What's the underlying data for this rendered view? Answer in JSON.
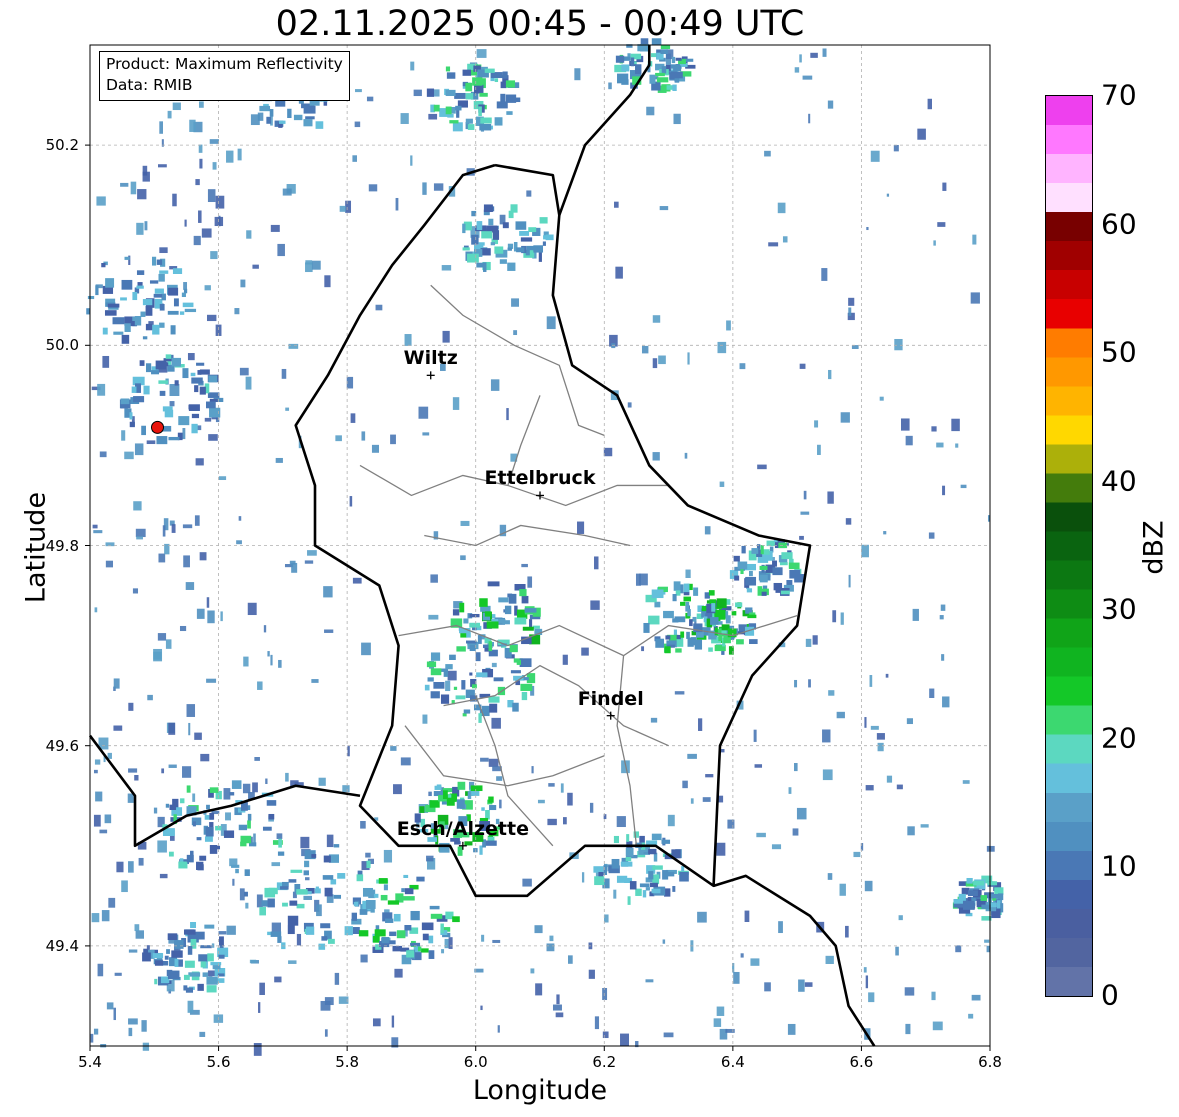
{
  "title": "02.11.2025 00:45 - 00:49 UTC",
  "info": {
    "product": "Product: Maximum Reflectivity",
    "data": "Data: RMIB"
  },
  "axes": {
    "xlabel": "Longitude",
    "ylabel": "Latitude",
    "xlim": [
      5.4,
      6.8
    ],
    "ylim": [
      49.3,
      50.3
    ],
    "xticks": [
      "5.4",
      "5.6",
      "5.8",
      "6.0",
      "6.2",
      "6.4",
      "6.6",
      "6.8"
    ],
    "yticks": [
      "49.4",
      "49.6",
      "49.8",
      "50.0",
      "50.2"
    ]
  },
  "cities": [
    {
      "name": "Wiltz",
      "lon": 5.93,
      "lat": 49.97
    },
    {
      "name": "Ettelbruck",
      "lon": 6.1,
      "lat": 49.85
    },
    {
      "name": "Findel",
      "lon": 6.21,
      "lat": 49.63
    },
    {
      "name": "Esch/Alzette",
      "lon": 5.98,
      "lat": 49.5
    }
  ],
  "radar_marker": {
    "lon": 5.505,
    "lat": 49.918,
    "color": "#e8140c"
  },
  "colorbar": {
    "label": "dBZ",
    "min": 0,
    "max": 70,
    "ticks": [
      "0",
      "10",
      "20",
      "30",
      "40",
      "50",
      "60",
      "70"
    ],
    "colors": [
      "#6273a8",
      "#5265a0",
      "#4a5fa0",
      "#4462a8",
      "#4a78b5",
      "#5090c0",
      "#5aa0c8",
      "#64c0dc",
      "#5cd8c0",
      "#3cd870",
      "#14c828",
      "#10b420",
      "#10a418",
      "#0e8c14",
      "#0c7812",
      "#0a6410",
      "#0a500c",
      "#447c0c",
      "#acb00a",
      "#ffd800",
      "#ffb400",
      "#ff9800",
      "#ff7c00",
      "#e80000",
      "#c80000",
      "#a00000",
      "#780000",
      "#ffe0ff",
      "#ffb4ff",
      "#ff78ff",
      "#ee40ee"
    ]
  },
  "echoes": [
    {
      "lon": 5.47,
      "lat": 50.05,
      "r": 0.06,
      "level": 2
    },
    {
      "lon": 5.52,
      "lat": 49.95,
      "r": 0.06,
      "level": 3
    },
    {
      "lon": 5.6,
      "lat": 49.52,
      "r": 0.07,
      "level": 4
    },
    {
      "lon": 5.75,
      "lat": 49.45,
      "r": 0.08,
      "level": 3
    },
    {
      "lon": 5.88,
      "lat": 49.43,
      "r": 0.06,
      "level": 5
    },
    {
      "lon": 5.97,
      "lat": 49.53,
      "r": 0.05,
      "level": 6
    },
    {
      "lon": 6.03,
      "lat": 49.73,
      "r": 0.05,
      "level": 6
    },
    {
      "lon": 6.0,
      "lat": 49.67,
      "r": 0.06,
      "level": 4
    },
    {
      "lon": 6.32,
      "lat": 49.73,
      "r": 0.05,
      "level": 5
    },
    {
      "lon": 6.38,
      "lat": 49.72,
      "r": 0.04,
      "level": 6
    },
    {
      "lon": 6.45,
      "lat": 49.78,
      "r": 0.04,
      "level": 4
    },
    {
      "lon": 6.04,
      "lat": 50.11,
      "r": 0.05,
      "level": 3
    },
    {
      "lon": 5.99,
      "lat": 50.25,
      "r": 0.05,
      "level": 4
    },
    {
      "lon": 5.72,
      "lat": 50.25,
      "r": 0.05,
      "level": 2
    },
    {
      "lon": 6.27,
      "lat": 50.28,
      "r": 0.04,
      "level": 4
    },
    {
      "lon": 5.55,
      "lat": 49.39,
      "r": 0.05,
      "level": 3
    },
    {
      "lon": 6.25,
      "lat": 49.48,
      "r": 0.05,
      "level": 3
    },
    {
      "lon": 6.78,
      "lat": 49.45,
      "r": 0.03,
      "level": 4
    }
  ]
}
